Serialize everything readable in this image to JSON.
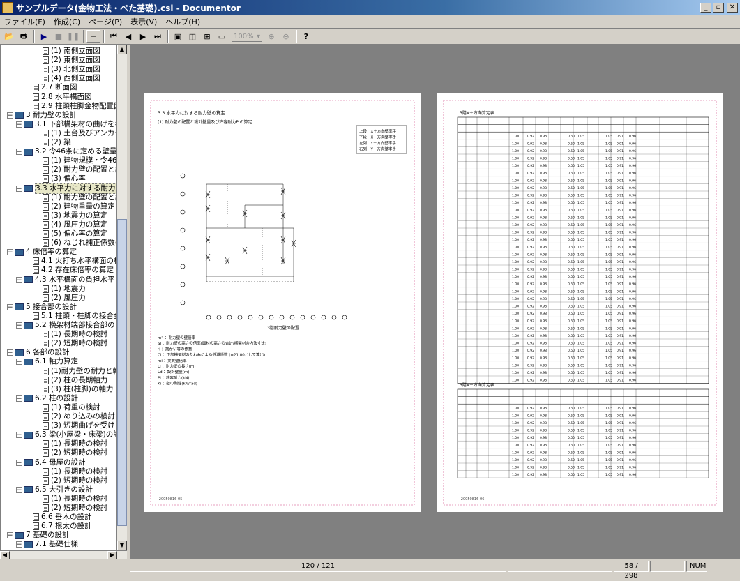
{
  "window": {
    "title": "サンプルデータ(金物工法・べた基礎).csi - Documentor"
  },
  "menu": [
    "ファイル(F)",
    "作成(C)",
    "ページ(P)",
    "表示(V)",
    "ヘルプ(H)"
  ],
  "toolbar": {
    "zoom": "100%"
  },
  "tree": [
    {
      "level": 4,
      "toggle": "",
      "icon": "page",
      "label": "(1) 南側立面図"
    },
    {
      "level": 4,
      "toggle": "",
      "icon": "page",
      "label": "(2) 東側立面図"
    },
    {
      "level": 4,
      "toggle": "",
      "icon": "page",
      "label": "(3) 北側立面図"
    },
    {
      "level": 4,
      "toggle": "",
      "icon": "page",
      "label": "(4) 西側立面図"
    },
    {
      "level": 3,
      "toggle": "",
      "icon": "page",
      "label": "2.7 断面図"
    },
    {
      "level": 3,
      "toggle": "",
      "icon": "page",
      "label": "2.8 水平構面図"
    },
    {
      "level": 3,
      "toggle": "",
      "icon": "page",
      "label": "2.9 柱頭柱脚金物配置図"
    },
    {
      "level": 1,
      "toggle": "−",
      "icon": "book",
      "label": "3 耐力壁の設計"
    },
    {
      "level": 2,
      "toggle": "−",
      "icon": "book",
      "label": "3.1 下部構架材の曲げを考"
    },
    {
      "level": 4,
      "toggle": "",
      "icon": "page",
      "label": "(1) 土台及びアンカーボ"
    },
    {
      "level": 4,
      "toggle": "",
      "icon": "page",
      "label": "(2) 梁"
    },
    {
      "level": 2,
      "toggle": "−",
      "icon": "book",
      "label": "3.2 令46条に定める壁量"
    },
    {
      "level": 4,
      "toggle": "",
      "icon": "page",
      "label": "(1) 建物規模・令46条"
    },
    {
      "level": 4,
      "toggle": "",
      "icon": "page",
      "label": "(2) 耐力壁の配置と許"
    },
    {
      "level": 4,
      "toggle": "",
      "icon": "page",
      "label": "(3) 偏心率"
    },
    {
      "level": 2,
      "toggle": "−",
      "icon": "book",
      "label": "3.3 水平力に対する耐力壁",
      "selected": true
    },
    {
      "level": 4,
      "toggle": "",
      "icon": "page",
      "label": "(1) 耐力壁の配置と許"
    },
    {
      "level": 4,
      "toggle": "",
      "icon": "page",
      "label": "(2) 建物重量の算定"
    },
    {
      "level": 4,
      "toggle": "",
      "icon": "page",
      "label": "(3) 地震力の算定"
    },
    {
      "level": 4,
      "toggle": "",
      "icon": "page",
      "label": "(4) 風圧力の算定"
    },
    {
      "level": 4,
      "toggle": "",
      "icon": "page",
      "label": "(5) 偏心率の算定"
    },
    {
      "level": 4,
      "toggle": "",
      "icon": "page",
      "label": "(6) ねじれ補正係数の"
    },
    {
      "level": 1,
      "toggle": "−",
      "icon": "book",
      "label": "4 床倍率の算定"
    },
    {
      "level": 3,
      "toggle": "",
      "icon": "page",
      "label": "4.1 火打ち水平構面の検"
    },
    {
      "level": 3,
      "toggle": "",
      "icon": "page",
      "label": "4.2 存在床倍率の算定"
    },
    {
      "level": 2,
      "toggle": "−",
      "icon": "book",
      "label": "4.3 水平構面の負担水平"
    },
    {
      "level": 4,
      "toggle": "",
      "icon": "page",
      "label": "(1) 地震力"
    },
    {
      "level": 4,
      "toggle": "",
      "icon": "page",
      "label": "(2) 風圧力"
    },
    {
      "level": 1,
      "toggle": "−",
      "icon": "book",
      "label": "5 接合部の設計"
    },
    {
      "level": 3,
      "toggle": "",
      "icon": "page",
      "label": "5.1 柱頭・柱脚の接合金物"
    },
    {
      "level": 2,
      "toggle": "−",
      "icon": "book",
      "label": "5.2 横架材端部接合部の"
    },
    {
      "level": 4,
      "toggle": "",
      "icon": "page",
      "label": "(1) 長期時の検討"
    },
    {
      "level": 4,
      "toggle": "",
      "icon": "page",
      "label": "(2) 短期時の検討"
    },
    {
      "level": 1,
      "toggle": "−",
      "icon": "book",
      "label": "6 各部の設計"
    },
    {
      "level": 2,
      "toggle": "−",
      "icon": "book",
      "label": "6.1 軸力算定"
    },
    {
      "level": 4,
      "toggle": "",
      "icon": "page",
      "label": "(1)耐力壁の耐力と軸"
    },
    {
      "level": 4,
      "toggle": "",
      "icon": "page",
      "label": "(2) 柱の長期軸力"
    },
    {
      "level": 4,
      "toggle": "",
      "icon": "page",
      "label": "(3) 柱(柱脚)の軸力・"
    },
    {
      "level": 2,
      "toggle": "−",
      "icon": "book",
      "label": "6.2 柱の設計"
    },
    {
      "level": 4,
      "toggle": "",
      "icon": "page",
      "label": "(1) 荷重の検討"
    },
    {
      "level": 4,
      "toggle": "",
      "icon": "page",
      "label": "(2) めり込みの検討"
    },
    {
      "level": 4,
      "toggle": "",
      "icon": "page",
      "label": "(3) 短期曲げを受ける"
    },
    {
      "level": 2,
      "toggle": "−",
      "icon": "book",
      "label": "6.3 梁(小屋梁・床梁)の設"
    },
    {
      "level": 4,
      "toggle": "",
      "icon": "page",
      "label": "(1) 長期時の検討"
    },
    {
      "level": 4,
      "toggle": "",
      "icon": "page",
      "label": "(2) 短期時の検討"
    },
    {
      "level": 2,
      "toggle": "−",
      "icon": "book",
      "label": "6.4 母屋の設計"
    },
    {
      "level": 4,
      "toggle": "",
      "icon": "page",
      "label": "(1) 長期時の検討"
    },
    {
      "level": 4,
      "toggle": "",
      "icon": "page",
      "label": "(2) 短期時の検討"
    },
    {
      "level": 2,
      "toggle": "−",
      "icon": "book",
      "label": "6.5 大引きの設計"
    },
    {
      "level": 4,
      "toggle": "",
      "icon": "page",
      "label": "(1) 長期時の検討"
    },
    {
      "level": 4,
      "toggle": "",
      "icon": "page",
      "label": "(2) 短期時の検討"
    },
    {
      "level": 3,
      "toggle": "",
      "icon": "page",
      "label": "6.6 垂木の設計"
    },
    {
      "level": 3,
      "toggle": "",
      "icon": "page",
      "label": "6.7 根太の設計"
    },
    {
      "level": 1,
      "toggle": "−",
      "icon": "book",
      "label": "7 基礎の設計"
    },
    {
      "level": 2,
      "toggle": "−",
      "icon": "book",
      "label": "7.1 基礎仕様"
    }
  ],
  "left_page": {
    "heading": "3.3 水平力に対する耐力壁の算定",
    "subheading": "(1) 耐力壁の配置と設計壁量及び許容耐力Piの算定",
    "legend": [
      "上段：X＋方向壁率手",
      "下段：X－方向壁率手",
      "左列：Y＋方向壁率手",
      "右列：Y－方向壁率手"
    ],
    "caption": "3階耐力壁の配置",
    "notes": [
      "m'i ：耐力壁の壁倍率",
      "Si ：耐力壁の高さの倍率(面材の高さの合計/横架材の内法寸法)",
      "ri ：筋かい等の係数",
      "Ci ：下部横架材のたわみによる低減係数 (=21.00として算出)",
      "mi ：実質壁倍率",
      "Li ：耐力壁の長さ(m)",
      "Ld ：設計壁量(m)",
      "Pi ：許容耐力(kN)",
      "Ki ：壁の剛性(kN/rad)"
    ],
    "footer": "-20050816-05"
  },
  "right_page": {
    "section1_title": "3階X＋方向算定表",
    "section2_title": "3階X－方向算定表",
    "footer": "-20050816-06"
  },
  "status": {
    "page_of": "120 / 121",
    "position": "58 / 298",
    "num": "NUM"
  }
}
